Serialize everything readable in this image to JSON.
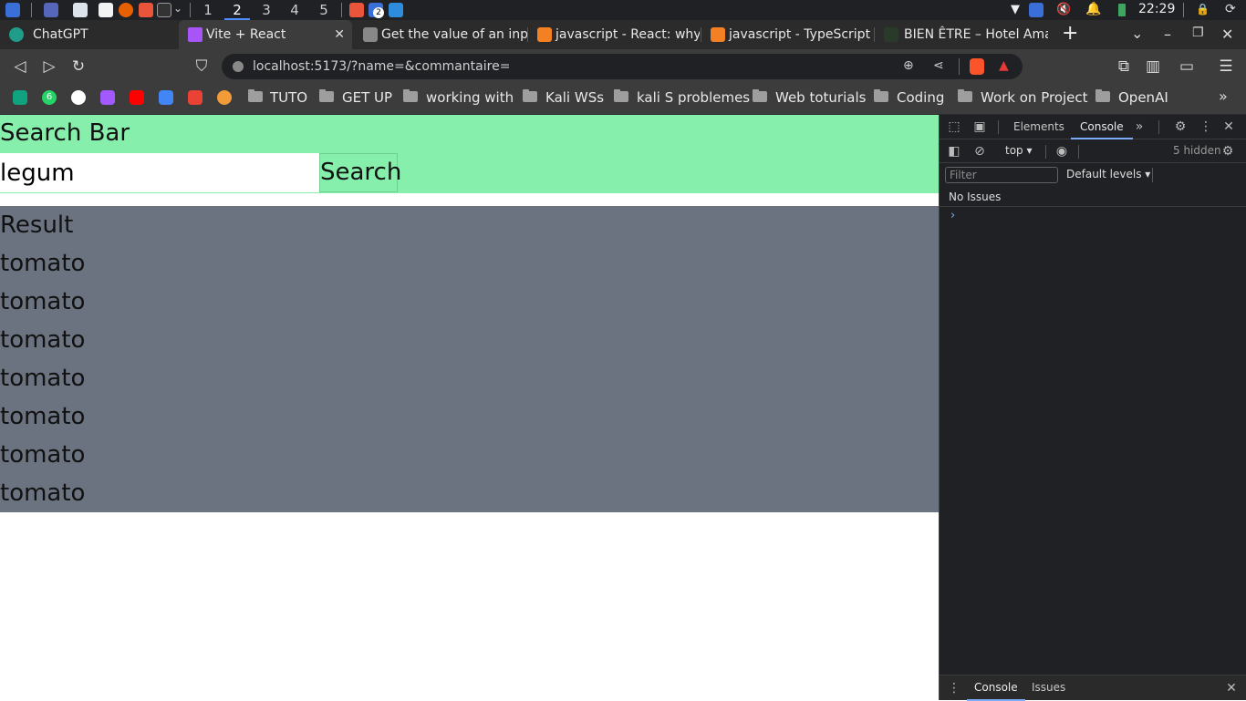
{
  "taskbar": {
    "workspaces": [
      "1",
      "2",
      "3",
      "4",
      "5"
    ],
    "active_workspace": "2",
    "badge": "2",
    "clock": "22:29"
  },
  "tabs": [
    {
      "label": "ChatGPT",
      "active": false
    },
    {
      "label": "Vite + React",
      "active": true
    },
    {
      "label": "Get the value of an inpu",
      "active": false
    },
    {
      "label": "javascript - React: why",
      "active": false
    },
    {
      "label": "javascript - TypeScript",
      "active": false
    },
    {
      "label": "BIEN ÊTRE – Hotel Ama",
      "active": false
    }
  ],
  "address": {
    "url": "localhost:5173/?name=&commantaire="
  },
  "bookmarks": {
    "badge": "6",
    "folders": [
      "TUTO",
      "GET UP",
      "working with",
      "Kali WSs",
      "kali S problemes",
      "Web toturials",
      "Coding",
      "Work on Project",
      "OpenAI"
    ]
  },
  "page": {
    "search_title": "Search Bar",
    "search_value": "legum",
    "search_button": "Search",
    "result_title": "Result",
    "results": [
      "tomato",
      "tomato",
      "tomato",
      "tomato",
      "tomato",
      "tomato",
      "tomato"
    ]
  },
  "devtools": {
    "tab_elements": "Elements",
    "tab_console": "Console",
    "context": "top",
    "hidden": "5 hidden",
    "filter_placeholder": "Filter",
    "levels": "Default levels",
    "no_issues": "No Issues",
    "drawer_console": "Console",
    "drawer_issues": "Issues"
  },
  "colors": {
    "search_panel": "#86efac",
    "result_panel": "#6b7280",
    "accent": "#4c8dff"
  }
}
